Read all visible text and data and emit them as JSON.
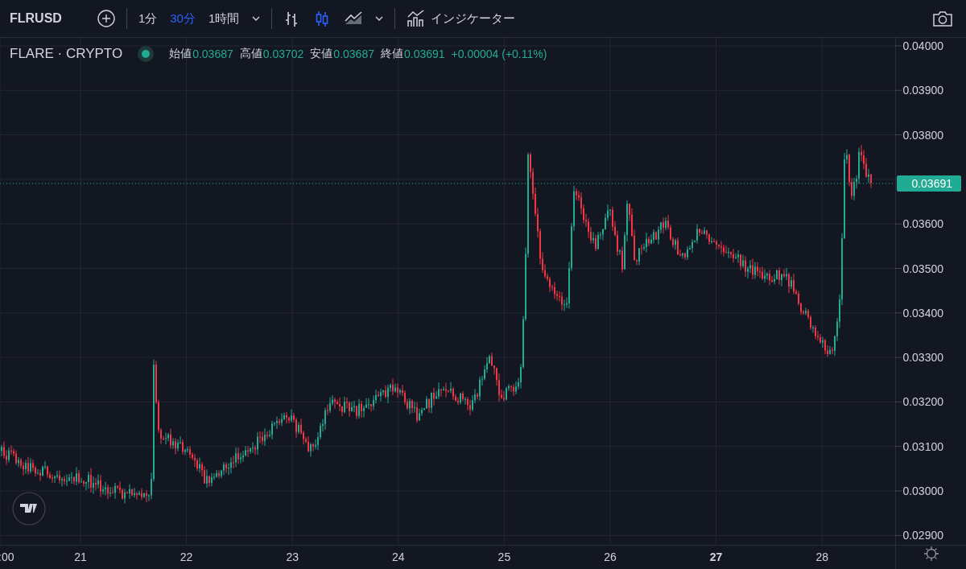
{
  "toolbar": {
    "symbol": "FLRUSD",
    "intervals": [
      {
        "label": "1分",
        "selected": false
      },
      {
        "label": "30分",
        "selected": true
      },
      {
        "label": "1時間",
        "selected": false
      }
    ],
    "chart_types": [
      {
        "kind": "bars",
        "selected": false
      },
      {
        "kind": "candles",
        "selected": true
      },
      {
        "kind": "area",
        "selected": false
      }
    ],
    "indicators_label": "インジケーター"
  },
  "legend": {
    "title": "FLARE · CRYPTO",
    "values": [
      {
        "label": "始値",
        "value": "0.03687"
      },
      {
        "label": "高値",
        "value": "0.03702"
      },
      {
        "label": "安値",
        "value": "0.03687"
      },
      {
        "label": "終値",
        "value": "0.03691"
      }
    ],
    "change": "+0.00004 (+0.11%)"
  },
  "price_axis": {
    "ticks": [
      "0.04000",
      "0.03900",
      "0.03800",
      "0.03600",
      "0.03500",
      "0.03400",
      "0.03300",
      "0.03200",
      "0.03100",
      "0.03000",
      "0.02900"
    ],
    "last_price": "0.03691"
  },
  "time_axis": {
    "labels": [
      {
        "text": ":00",
        "bold": false
      },
      {
        "text": "21",
        "bold": false
      },
      {
        "text": "22",
        "bold": false
      },
      {
        "text": "23",
        "bold": false
      },
      {
        "text": "24",
        "bold": false
      },
      {
        "text": "25",
        "bold": false
      },
      {
        "text": "26",
        "bold": false
      },
      {
        "text": "27",
        "bold": true
      },
      {
        "text": "28",
        "bold": false
      }
    ]
  }
}
